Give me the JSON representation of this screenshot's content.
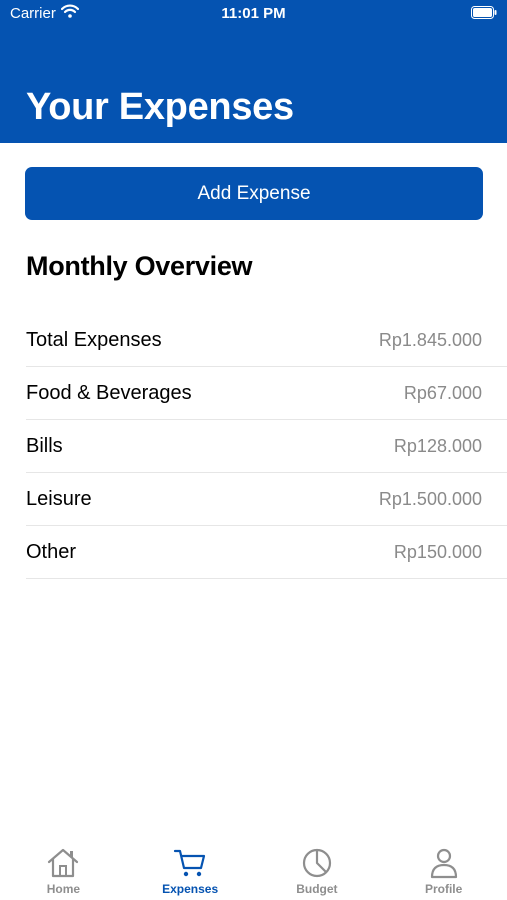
{
  "status_bar": {
    "carrier": "Carrier",
    "time": "11:01 PM"
  },
  "header": {
    "title": "Your Expenses"
  },
  "actions": {
    "add_expense_label": "Add Expense"
  },
  "overview": {
    "title": "Monthly Overview",
    "items": [
      {
        "label": "Total Expenses",
        "value": "Rp1.845.000"
      },
      {
        "label": "Food & Beverages",
        "value": "Rp67.000"
      },
      {
        "label": "Bills",
        "value": "Rp128.000"
      },
      {
        "label": "Leisure",
        "value": "Rp1.500.000"
      },
      {
        "label": "Other",
        "value": "Rp150.000"
      }
    ]
  },
  "tabbar": {
    "active": "Expenses",
    "tabs": [
      {
        "label": "Home",
        "icon": "house-icon"
      },
      {
        "label": "Expenses",
        "icon": "cart-icon"
      },
      {
        "label": "Budget",
        "icon": "pie-chart-icon"
      },
      {
        "label": "Profile",
        "icon": "person-icon"
      }
    ]
  },
  "colors": {
    "accent": "#0553b1",
    "secondary_text": "#8a8a8a",
    "inactive_tab": "#8e8e8e"
  }
}
